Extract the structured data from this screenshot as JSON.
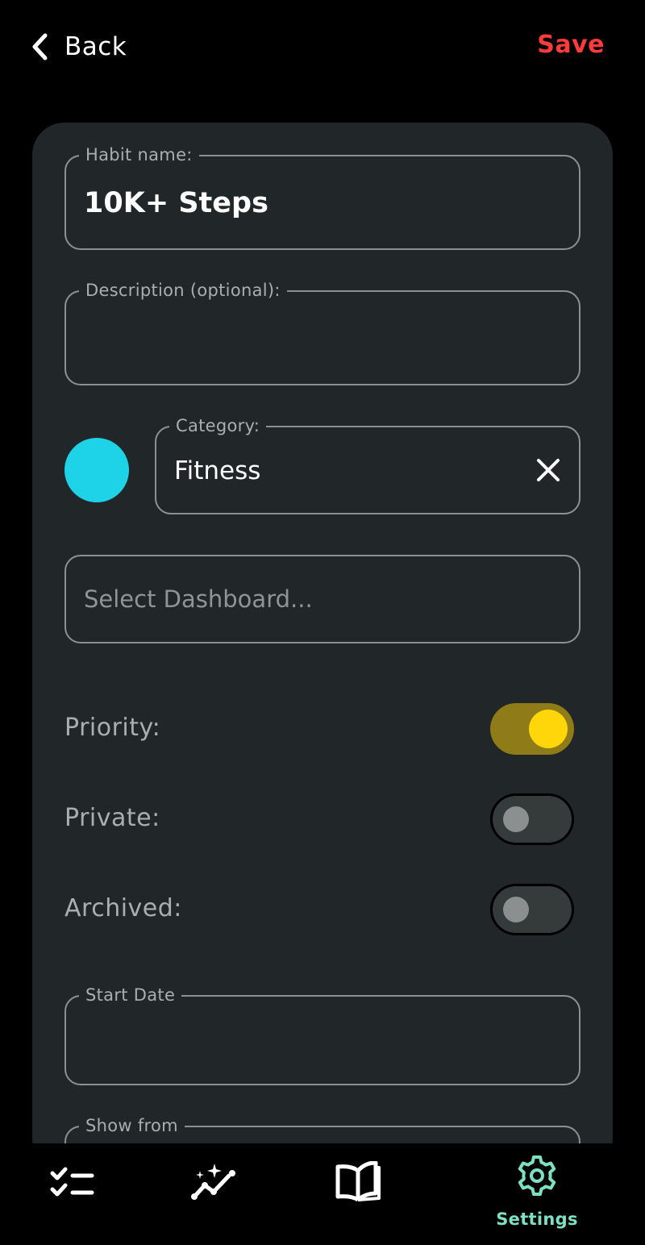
{
  "header": {
    "back_label": "Back",
    "save_label": "Save",
    "save_color": "#ff3b3b"
  },
  "form": {
    "habit_name": {
      "label": "Habit name:",
      "value": "10K+ Steps"
    },
    "description": {
      "label": "Description (optional):",
      "value": ""
    },
    "color": "#1ed3e8",
    "category": {
      "label": "Category:",
      "value": "Fitness",
      "clear_icon": "close-icon"
    },
    "dashboard": {
      "placeholder": "Select Dashboard..."
    },
    "priority": {
      "label": "Priority:",
      "enabled": true
    },
    "private": {
      "label": "Private:",
      "enabled": false
    },
    "archived": {
      "label": "Archived:",
      "enabled": false
    },
    "start_date": {
      "label": "Start Date",
      "value": ""
    },
    "show_from": {
      "label": "Show from"
    }
  },
  "nav": {
    "items": [
      {
        "icon": "checklist-icon",
        "label": ""
      },
      {
        "icon": "stats-sparkle-icon",
        "label": ""
      },
      {
        "icon": "book-icon",
        "label": ""
      },
      {
        "icon": "gear-icon",
        "label": "Settings",
        "active": true
      }
    ],
    "active_color": "#7ee0c2"
  }
}
